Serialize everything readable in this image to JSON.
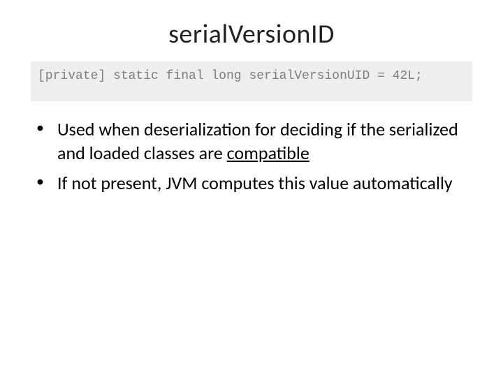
{
  "title": "serialVersionID",
  "code": "[private] static final long serialVersionUID = 42L;",
  "bullets": {
    "b1_pre": " Used when deserialization for deciding if the serialized and loaded classes are ",
    "b1_underlined": "compatible",
    "b2": " If not present, JVM computes this value automatically"
  }
}
